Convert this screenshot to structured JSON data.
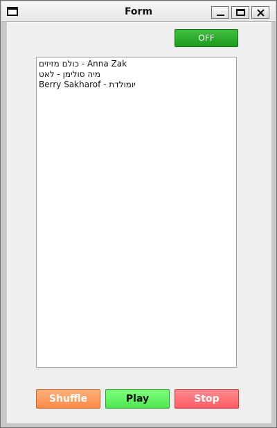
{
  "window": {
    "title": "Form"
  },
  "toggle": {
    "label": "OFF",
    "color": "#2fae2f"
  },
  "playlist": {
    "items": [
      "כולם מזיזים - Anna Zak",
      "מיה סולימן - לאט",
      "Berry Sakharof - יומולדת"
    ]
  },
  "buttons": {
    "shuffle": "Shuffle",
    "play": "Play",
    "stop": "Stop"
  },
  "colors": {
    "shuffle": "#ff9a5e",
    "play": "#5cf25c",
    "stop": "#ff6a70"
  }
}
